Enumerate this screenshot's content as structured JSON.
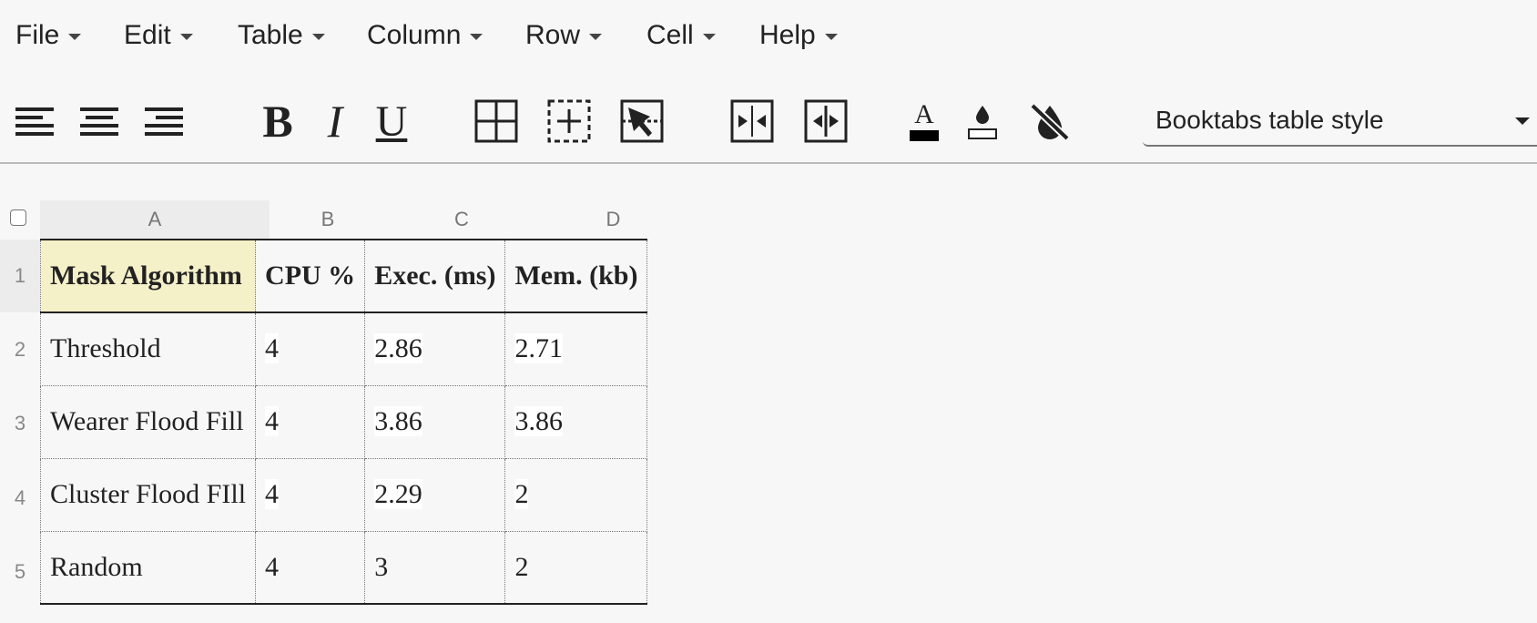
{
  "menu": [
    {
      "label": "File"
    },
    {
      "label": "Edit"
    },
    {
      "label": "Table"
    },
    {
      "label": "Column"
    },
    {
      "label": "Row"
    },
    {
      "label": "Cell"
    },
    {
      "label": "Help"
    }
  ],
  "toolbar": {
    "buttons": [
      {
        "icon": "align-left-icon"
      },
      {
        "icon": "align-center-icon"
      },
      {
        "icon": "align-right-icon"
      },
      {
        "icon": "bold-icon",
        "glyph": "B"
      },
      {
        "icon": "italic-icon",
        "glyph": "I"
      },
      {
        "icon": "underline-icon",
        "glyph": "U"
      },
      {
        "icon": "all-borders-icon"
      },
      {
        "icon": "inner-borders-icon"
      },
      {
        "icon": "select-borders-icon"
      },
      {
        "icon": "merge-cells-icon"
      },
      {
        "icon": "split-cells-icon"
      },
      {
        "icon": "text-color-icon",
        "glyph": "A"
      },
      {
        "icon": "fill-color-icon"
      },
      {
        "icon": "no-fill-icon"
      }
    ],
    "style_select": "Booktabs table style"
  },
  "grid": {
    "columns": [
      "A",
      "B",
      "C",
      "D"
    ],
    "rows": [
      "1",
      "2",
      "3",
      "4",
      "5"
    ],
    "header": [
      "Mask Algorithm",
      "CPU %",
      "Exec. (ms)",
      "Mem. (kb)"
    ],
    "body": [
      [
        "Threshold",
        "4",
        "2.86",
        "2.71"
      ],
      [
        "Wearer Flood Fill",
        "4",
        "3.86",
        "3.86"
      ],
      [
        "Cluster Flood FIll",
        "4",
        "2.29",
        "2"
      ],
      [
        "Random",
        "4",
        "3",
        "2"
      ]
    ]
  },
  "colors": {
    "header_highlight": "#f4f0c8",
    "background": "#f7f7f7"
  }
}
